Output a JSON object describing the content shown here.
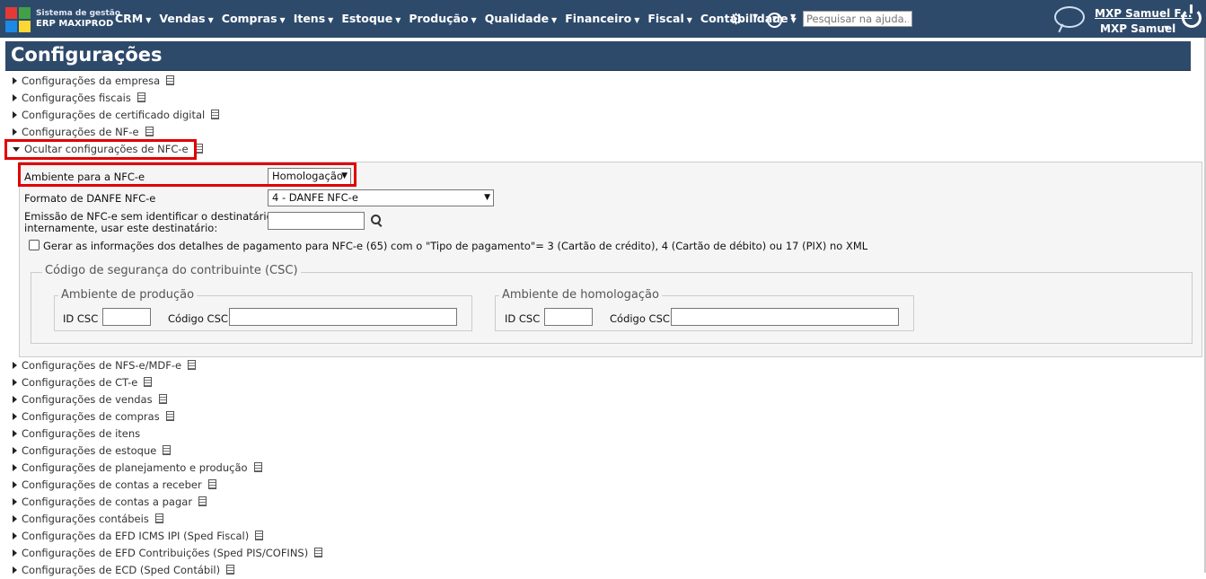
{
  "header": {
    "brand_line1": "Sistema de gestão",
    "brand_line2": "ERP MAXIPROD",
    "menu": [
      "CRM",
      "Vendas",
      "Compras",
      "Itens",
      "Estoque",
      "Produção",
      "Qualidade",
      "Financeiro",
      "Fiscal",
      "Contabilidade"
    ],
    "search_placeholder": "Pesquisar na ajuda...",
    "user_name": "MXP Samuel F...",
    "user_short": "MXP Samuel",
    "icons": [
      "settings-gear-icon",
      "help-icon",
      "chat-icon",
      "power-icon"
    ]
  },
  "page": {
    "title": "Configurações"
  },
  "sections_top": [
    "Configurações da empresa",
    "Configurações fiscais",
    "Configurações de certificado digital",
    "Configurações de NF-e"
  ],
  "expanded_section": "Ocultar configurações de NFC-e",
  "nfce": {
    "ambiente_label": "Ambiente para a NFC-e",
    "ambiente_value": "Homologação",
    "formato_label": "Formato de DANFE NFC-e",
    "formato_value": "4 - DANFE NFC-e",
    "emissao_label_1": "Emissão de NFC-e sem identificar o destinatário:",
    "emissao_label_2": "internamente, usar este destinatário:",
    "checkbox_label": "Gerar as informações dos detalhes de pagamento para NFC-e (65) com o \"Tipo de pagamento\"= 3 (Cartão de crédito), 4 (Cartão de débito) ou 17 (PIX) no XML",
    "csc_legend": "Código de segurança do contribuinte (CSC)",
    "producao_legend": "Ambiente de produção",
    "homologacao_legend": "Ambiente de homologação",
    "id_csc_label": "ID CSC",
    "codigo_csc_label": "Código CSC"
  },
  "sections_bottom": [
    {
      "label": "Configurações de NFS-e/MDF-e",
      "doc": true
    },
    {
      "label": "Configurações de CT-e",
      "doc": true
    },
    {
      "label": "Configurações de vendas",
      "doc": true
    },
    {
      "label": "Configurações de compras",
      "doc": true
    },
    {
      "label": "Configurações de itens",
      "doc": false
    },
    {
      "label": "Configurações de estoque",
      "doc": true
    },
    {
      "label": "Configurações de planejamento e produção",
      "doc": true
    },
    {
      "label": "Configurações de contas a receber",
      "doc": true
    },
    {
      "label": "Configurações de contas a pagar",
      "doc": true
    },
    {
      "label": "Configurações contábeis",
      "doc": true
    },
    {
      "label": "Configurações da EFD ICMS IPI (Sped Fiscal)",
      "doc": true
    },
    {
      "label": "Configurações de EFD Contribuições (Sped PIS/COFINS)",
      "doc": true
    },
    {
      "label": "Configurações de ECD (Sped Contábil)",
      "doc": true
    }
  ],
  "colors": {
    "header_bg": "#2e4a6b",
    "highlight": "#e00000"
  }
}
